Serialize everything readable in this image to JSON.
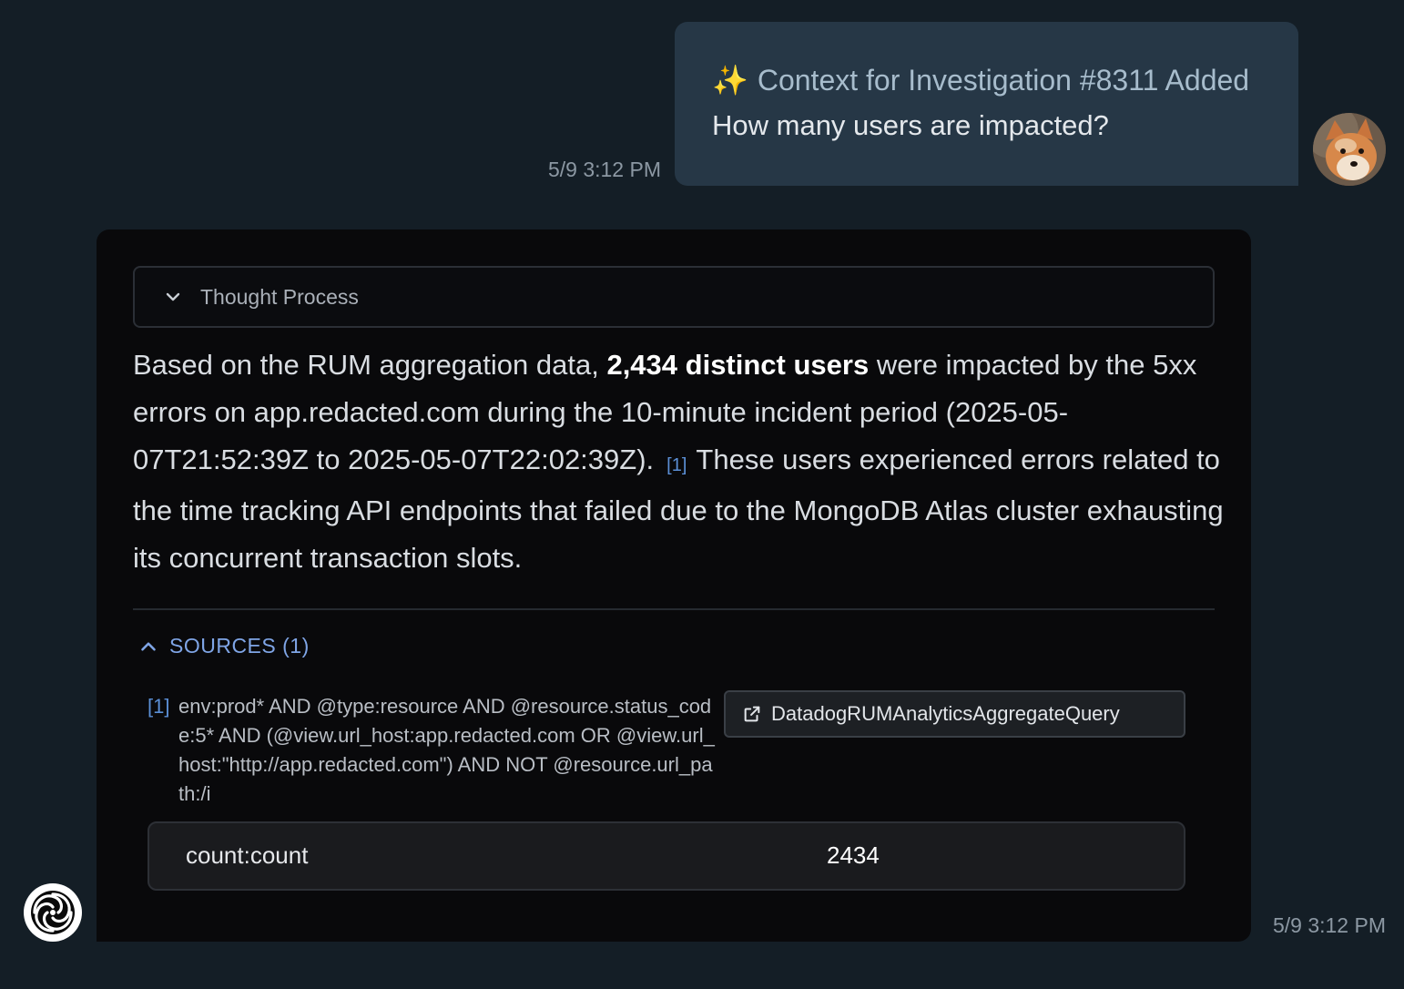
{
  "user_message": {
    "context_icon": "sparkles-icon",
    "context_text": "Context for Investigation #8311 Added",
    "question": "How many users are impacted?",
    "timestamp": "5/9 3:12 PM",
    "avatar": "shiba-dog-avatar"
  },
  "assistant_message": {
    "thought_process_label": "Thought Process",
    "answer": {
      "part1": "Based on the RUM aggregation data, ",
      "bold": "2,434 distinct users",
      "part2": " were impacted by the 5xx errors on app.redacted.com during the 10-minute incident period (2025-05-07T21:52:39Z to 2025-05-07T22:02:39Z).",
      "citation": "[1]",
      "part3": "These users experienced errors related to the time tracking API endpoints that failed due to the MongoDB Atlas cluster exhausting its concurrent transaction slots."
    },
    "sources_label": "SOURCES (1)",
    "sources": [
      {
        "num": "[1]",
        "query": "env:prod* AND @type:resource AND @resource.status_code:5* AND (@view.url_host:app.redacted.com OR @view.url_host:\"http://app.redacted.com\") AND NOT @resource.url_path:/i",
        "tool_label": "DatadogRUMAnalyticsAggregateQuery",
        "result_key": "count:count",
        "result_value": "2434"
      }
    ],
    "timestamp": "5/9 3:12 PM"
  },
  "colors": {
    "background": "#141e26",
    "user_bubble": "#263746",
    "assistant_card": "#09090b",
    "link_blue": "#5b8fd6",
    "sources_blue": "#7fa5e6"
  }
}
